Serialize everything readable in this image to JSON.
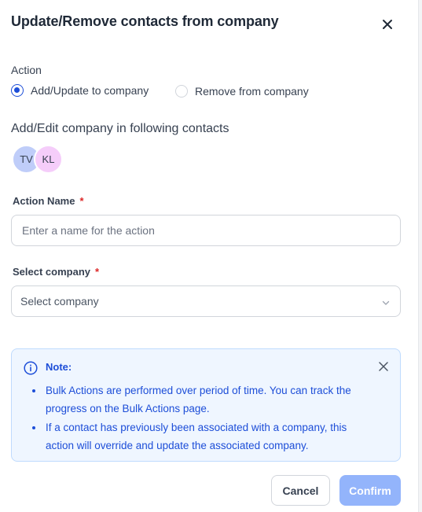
{
  "modal": {
    "title": "Update/Remove contacts from company"
  },
  "action": {
    "label": "Action",
    "options": [
      {
        "label": "Add/Update to company",
        "checked": true
      },
      {
        "label": "Remove from company",
        "checked": false
      }
    ]
  },
  "contacts": {
    "heading": "Add/Edit company in following contacts",
    "avatars": [
      {
        "initials": "TV",
        "color": "#bfcdf9"
      },
      {
        "initials": "KL",
        "color": "#f5cdfa"
      }
    ]
  },
  "action_name": {
    "label": "Action Name",
    "required_mark": "*",
    "placeholder": "Enter a name for the action"
  },
  "company": {
    "label": "Select company",
    "required_mark": "*",
    "placeholder": "Select company"
  },
  "note": {
    "title": "Note:",
    "items": [
      "Bulk Actions are performed over period of time. You can track the progress on the Bulk Actions page.",
      "If a contact has previously been associated with a company, this action will override and update the associated company."
    ]
  },
  "buttons": {
    "cancel": "Cancel",
    "confirm": "Confirm"
  },
  "colors": {
    "accent": "#1d4ed8",
    "confirm_disabled": "#93b4fb",
    "note_bg": "#eff6ff",
    "required": "#dc2626"
  }
}
